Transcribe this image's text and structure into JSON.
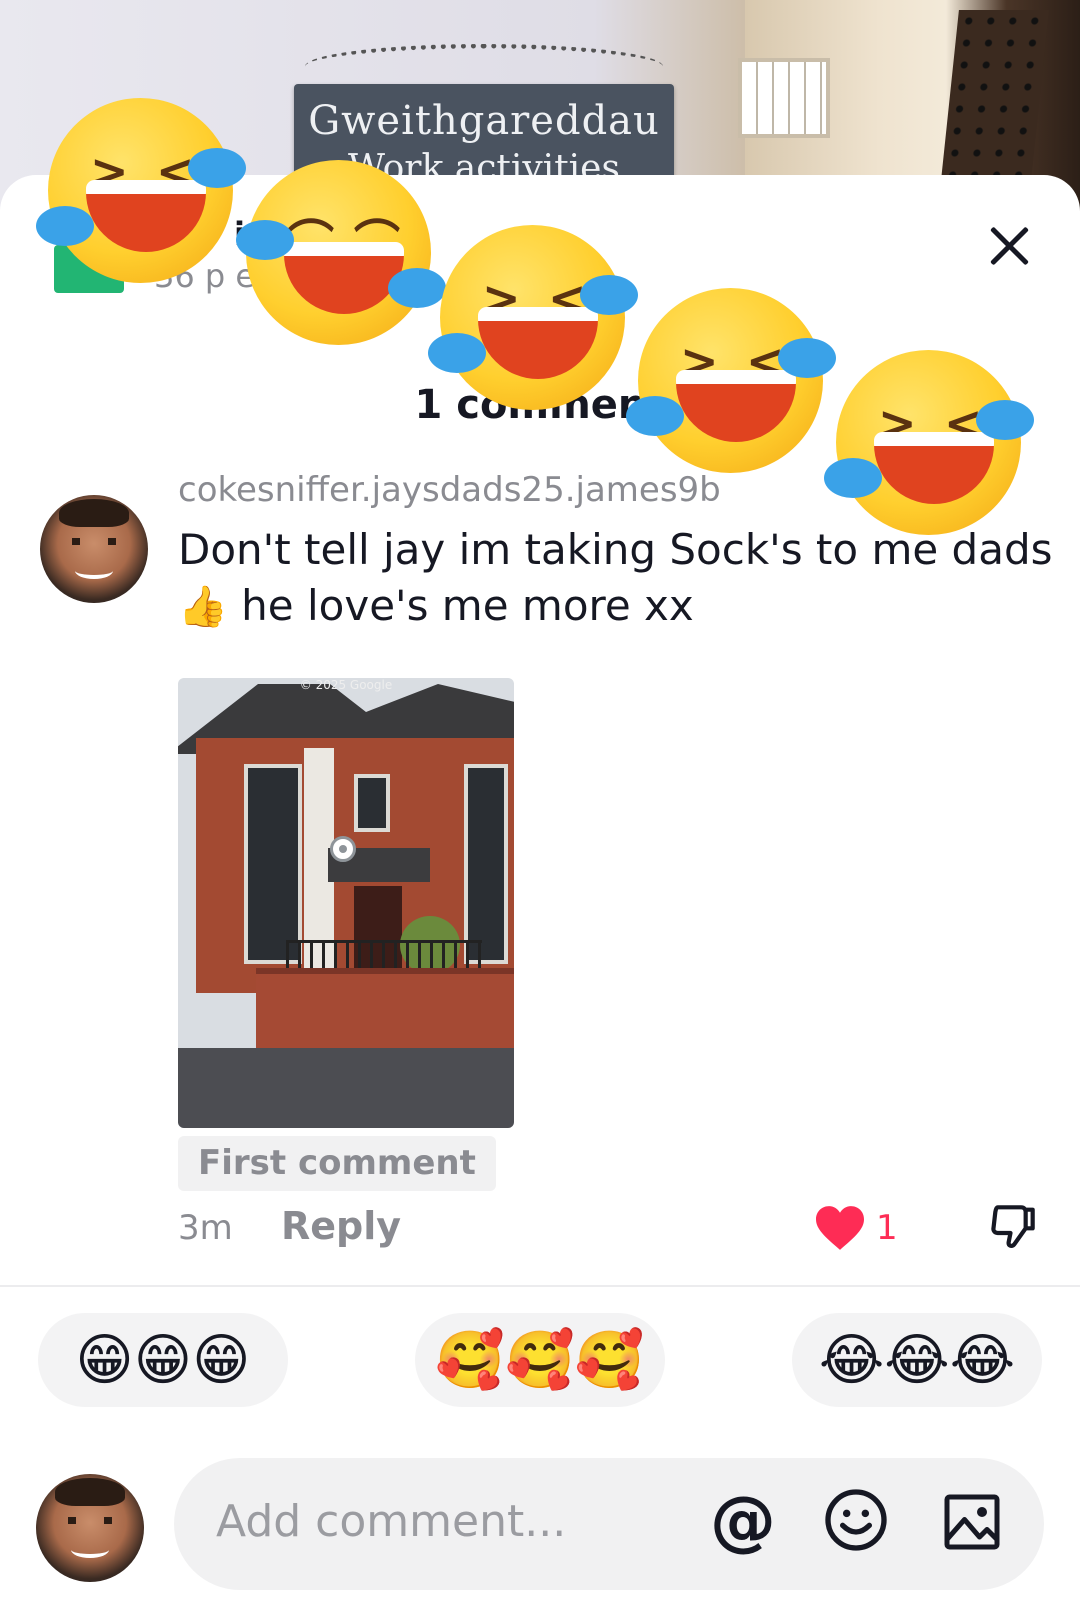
{
  "video": {
    "sign_line1": "Gweithgareddau",
    "sign_line2": "Work activities"
  },
  "header": {
    "name_fragment": "i",
    "meta_fragment": "36 p           e          s place",
    "comment_count": "1 comment"
  },
  "comment": {
    "username": "cokesniffer.jaysdads25.james9b",
    "text_line1": "Don't tell jay im taking Sock's to me dads",
    "thumb_emoji": "👍",
    "text_line2": " he love's me more xx",
    "image_copyright": "© 2025 Google",
    "badge": "First comment",
    "time": "3m",
    "reply_label": "Reply",
    "like_count": "1"
  },
  "quick_reactions": [
    {
      "emojis": "😁😁😁"
    },
    {
      "emojis": "🥰🥰🥰"
    },
    {
      "emojis": "😂😂😂"
    }
  ],
  "composer": {
    "placeholder": "Add comment...",
    "mention_icon": "at-icon",
    "emoji_icon": "emoji-icon",
    "image_icon": "image-icon"
  },
  "colors": {
    "like": "#fe2c55",
    "text": "#161823",
    "muted": "#8a8b91"
  }
}
